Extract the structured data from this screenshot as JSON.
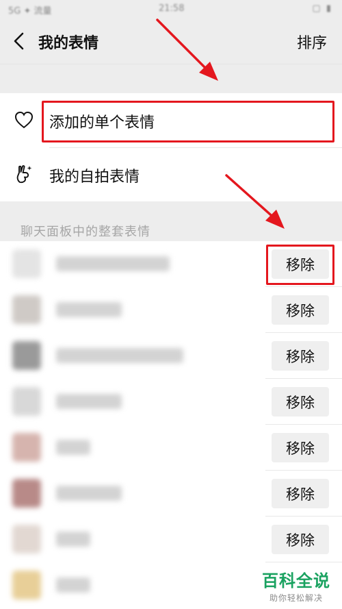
{
  "status_bar": {
    "left": "5G ✦ 流量",
    "center": "21:58",
    "right": "▢ ▮"
  },
  "nav": {
    "title": "我的表情",
    "sort_label": "排序"
  },
  "menu": {
    "items": [
      {
        "label": "添加的单个表情",
        "icon": "heart-icon"
      },
      {
        "label": "我的自拍表情",
        "icon": "selfie-hand-icon"
      }
    ]
  },
  "section": {
    "header": "聊天面板中的整套表情"
  },
  "packs": {
    "remove_label": "移除",
    "items": [
      {
        "name": "",
        "thumb_color": "#e4e4e4"
      },
      {
        "name": "",
        "thumb_color": "#cfcac6"
      },
      {
        "name": "",
        "thumb_color": "#9a9a9a"
      },
      {
        "name": "",
        "thumb_color": "#d8d8d8"
      },
      {
        "name": "",
        "thumb_color": "#d6b4ae"
      },
      {
        "name": "",
        "thumb_color": "#b88a88"
      },
      {
        "name": "",
        "thumb_color": "#e2d8d2"
      },
      {
        "name": "",
        "thumb_color": "#e8cf98"
      }
    ]
  },
  "watermark": {
    "brand": "百科全说",
    "slogan": "助你轻松解决"
  },
  "colors": {
    "accent_red": "#e4171e",
    "brand_green": "#1aa260"
  }
}
